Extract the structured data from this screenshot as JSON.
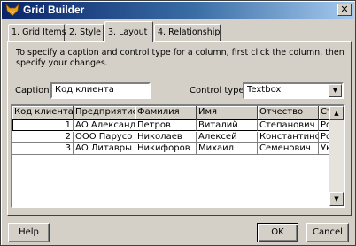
{
  "window": {
    "title": "Grid Builder",
    "close_glyph": "✕"
  },
  "tabs": [
    {
      "label": "1. Grid Items"
    },
    {
      "label": "2. Style"
    },
    {
      "label": "3. Layout",
      "active": true
    },
    {
      "label": "4. Relationship"
    }
  ],
  "layout": {
    "instructions": "To specify a caption and control type for a column, first click the column, then specify your changes.",
    "caption_label": "Caption:",
    "caption_value": "Код клиента",
    "control_type_label": "Control type:",
    "control_type_value": "Textbox"
  },
  "grid": {
    "columns": [
      "Код клиента",
      "Предприятие",
      "Фамилия",
      "Имя",
      "Отчество",
      "Ст"
    ],
    "rows": [
      {
        "cells": [
          "1",
          "АО Александ",
          "Петров",
          "Виталий",
          "Степанович",
          "Ро"
        ]
      },
      {
        "cells": [
          "2",
          "ООО Парусо",
          "Николаев",
          "Алексей",
          "Константино",
          "Ро"
        ]
      },
      {
        "cells": [
          "3",
          "АО Литавры",
          "Никифоров",
          "Михаил",
          "Семенович",
          "Ук"
        ]
      }
    ]
  },
  "buttons": {
    "help": "Help",
    "ok": "OK",
    "cancel": "Cancel"
  },
  "icons": {
    "title_icon": "fox-icon",
    "scroll_up": "▲",
    "scroll_down": "▼",
    "dropdown": "▼"
  }
}
